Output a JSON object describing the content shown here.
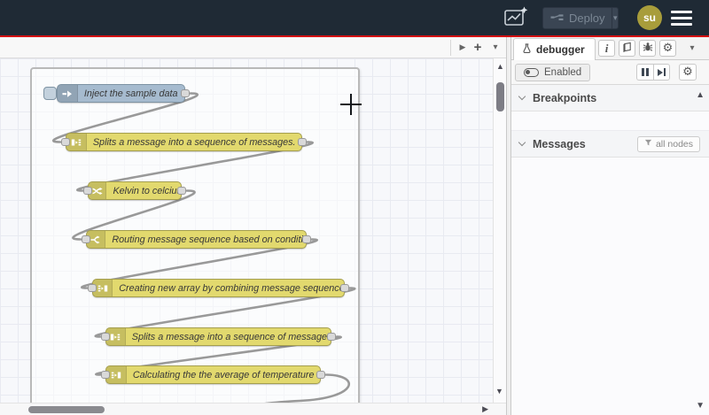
{
  "header": {
    "deploy": {
      "label": "Deploy"
    },
    "user_initials": "su"
  },
  "workspace": {
    "nodes": [
      {
        "type": "inject",
        "label": "Inject the sample data"
      },
      {
        "type": "split",
        "label": "Splits a message into a sequence of messages."
      },
      {
        "type": "change",
        "label": "Kelvin to celcius"
      },
      {
        "type": "switch",
        "label": "Routing message sequence based on condition"
      },
      {
        "type": "join",
        "label": "Creating new array by combining message sequence"
      },
      {
        "type": "split",
        "label": "Splits a message into a sequence of messages."
      },
      {
        "type": "join",
        "label": "Calculating the the average of temperature"
      }
    ]
  },
  "sidebar": {
    "active_tab": "debugger",
    "enabled_button": "Enabled",
    "breakpoints_header": "Breakpoints",
    "messages_header": "Messages",
    "filter_button": "all nodes"
  },
  "colors": {
    "header_bg": "#1f2a35",
    "accent_red": "#d40e12",
    "node_yellow": "#e2d96e",
    "node_inject_blue": "#a6bbcf",
    "wire_gray": "#999999",
    "avatar_olive": "#a89d3b"
  }
}
